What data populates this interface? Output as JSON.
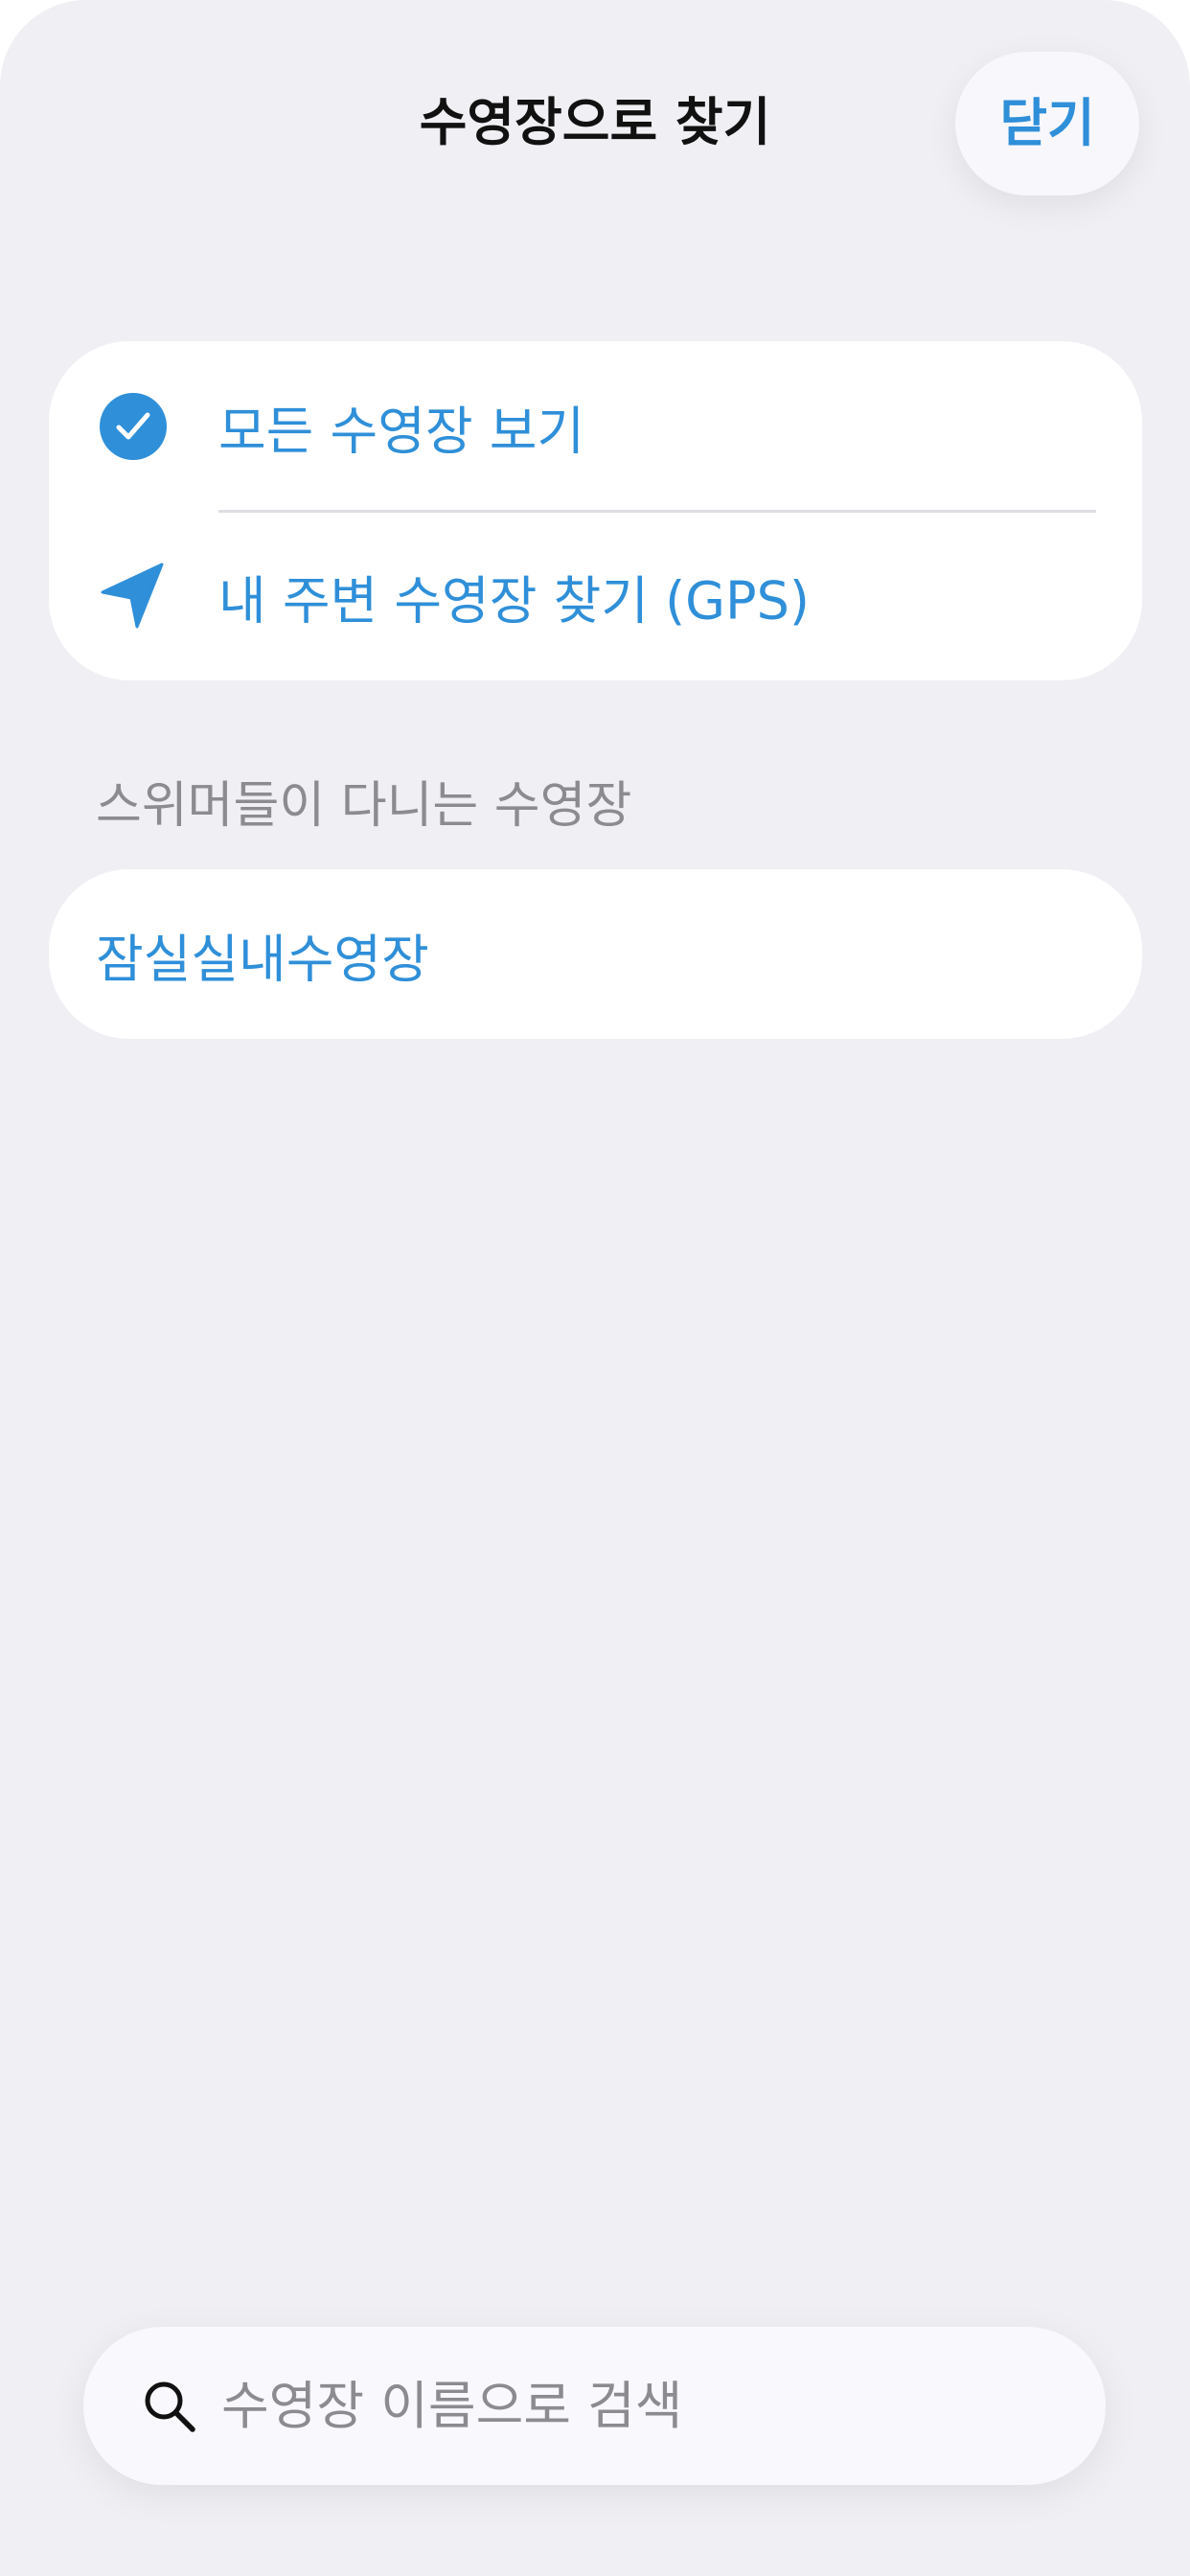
{
  "header": {
    "title": "수영장으로 찾기",
    "close_label": "닫기"
  },
  "options": [
    {
      "label": "모든 수영장 보기",
      "icon": "checkmark-circle-icon",
      "selected": true
    },
    {
      "label": "내 주변 수영장 찾기 (GPS)",
      "icon": "location-arrow-icon",
      "selected": false
    }
  ],
  "section": {
    "header": "스위머들이 다니는 수영장",
    "pools": [
      "잠실실내수영장"
    ]
  },
  "search": {
    "placeholder": "수영장 이름으로 검색",
    "value": ""
  },
  "colors": {
    "accent": "#2f8fd9",
    "background": "#efeff4",
    "card": "#ffffff",
    "secondary_text": "#8b8b90"
  }
}
